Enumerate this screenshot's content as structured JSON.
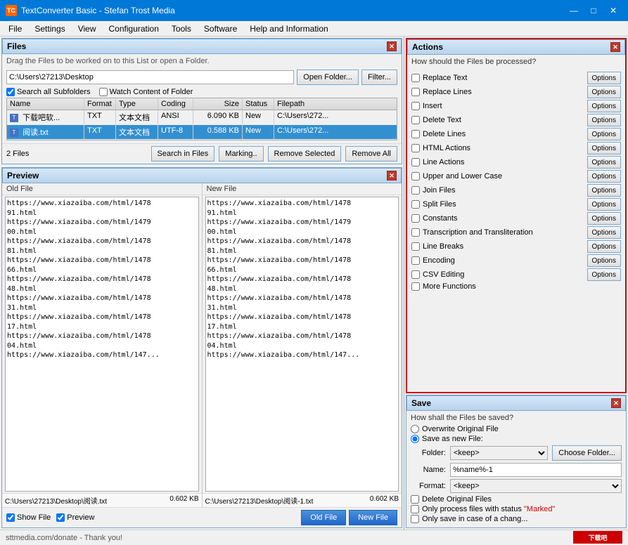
{
  "titleBar": {
    "icon": "TC",
    "title": "TextConverter Basic - Stefan Trost Media",
    "minimizeBtn": "—",
    "maximizeBtn": "□",
    "closeBtn": "✕"
  },
  "menuBar": {
    "items": [
      "File",
      "Settings",
      "View",
      "Configuration",
      "Tools",
      "Software",
      "Help and Information"
    ]
  },
  "files": {
    "panelTitle": "Files",
    "dragHint": "Drag the Files to be worked on to this List or open a Folder.",
    "pathValue": "C:\\Users\\27213\\Desktop",
    "openFolderBtn": "Open Folder...",
    "filterBtn": "Filter...",
    "searchAllSubfolders": "Search all Subfolders",
    "watchContentOfFolder": "Watch Content of Folder",
    "columns": [
      "Name",
      "Format",
      "Type",
      "Coding",
      "Size",
      "Status",
      "Filepath"
    ],
    "rows": [
      {
        "name": "下载吧软...",
        "format": "TXT",
        "type": "文本文档",
        "coding": "ANSI",
        "size": "6.090 KB",
        "status": "New",
        "filepath": "C:\\Users\\272..."
      },
      {
        "name": "阅读.txt",
        "format": "TXT",
        "type": "文本文档",
        "coding": "UTF-8",
        "size": "0.588 KB",
        "status": "New",
        "filepath": "C:\\Users\\272..."
      }
    ],
    "count": "2 Files",
    "searchInFilesBtn": "Search in Files",
    "markingBtn": "Marking..",
    "removeSelectedBtn": "Remove Selected",
    "removeAllBtn": "Remove All"
  },
  "preview": {
    "panelTitle": "Preview",
    "oldFileLabel": "Old File",
    "newFileLabel": "New File",
    "oldFileContent": "https://www.xiazaiba.com/html/1478\n91.html\nhttps://www.xiazaiba.com/html/1479\n00.html\nhttps://www.xiazaiba.com/html/1478\n81.html\nhttps://www.xiazaiba.com/html/1478\n66.html\nhttps://www.xiazaiba.com/html/1478\n48.html\nhttps://www.xiazaiba.com/html/1478\n31.html\nhttps://www.xiazaiba.com/html/1478\n17.html\nhttps://www.xiazaiba.com/html/1478\n04.html\nhttps://www.xiazaiba.com/html/147...",
    "newFileContent": "https://www.xiazaiba.com/html/1478\n91.html\nhttps://www.xiazaiba.com/html/1479\n00.html\nhttps://www.xiazaiba.com/html/1478\n81.html\nhttps://www.xiazaiba.com/html/1478\n66.html\nhttps://www.xiazaiba.com/html/1478\n48.html\nhttps://www.xiazaiba.com/html/1478\n31.html\nhttps://www.xiazaiba.com/html/1478\n17.html\nhttps://www.xiazaiba.com/html/1478\n04.html\nhttps://www.xiazaiba.com/html/147...",
    "oldFilePath": "C:\\Users\\27213\\Desktop\\阅读.txt",
    "oldFileSize": "0.602 KB",
    "newFilePath": "C:\\Users\\27213\\Desktop\\阅读-1.txt",
    "newFileSize": "0.602 KB",
    "showFileLabel": "Show File",
    "previewLabel": "Preview",
    "oldFileBtn": "Old File",
    "newFileBtn": "New File"
  },
  "actions": {
    "panelTitle": "Actions",
    "hint": "How should the Files be processed?",
    "items": [
      {
        "label": "Replace Text",
        "hasOptions": true,
        "checked": false
      },
      {
        "label": "Replace Lines",
        "hasOptions": true,
        "checked": false
      },
      {
        "label": "Insert",
        "hasOptions": true,
        "checked": false
      },
      {
        "label": "Delete Text",
        "hasOptions": true,
        "checked": false
      },
      {
        "label": "Delete Lines",
        "hasOptions": true,
        "checked": false
      },
      {
        "label": "HTML Actions",
        "hasOptions": true,
        "checked": false
      },
      {
        "label": "Line Actions",
        "hasOptions": true,
        "checked": false
      },
      {
        "label": "Upper and Lower Case",
        "hasOptions": true,
        "checked": false
      },
      {
        "label": "Join Files",
        "hasOptions": true,
        "checked": false
      },
      {
        "label": "Split Files",
        "hasOptions": true,
        "checked": false
      },
      {
        "label": "Constants",
        "hasOptions": true,
        "checked": false
      },
      {
        "label": "Transcription and Transliteration",
        "hasOptions": true,
        "checked": false
      },
      {
        "label": "Line Breaks",
        "hasOptions": true,
        "checked": false
      },
      {
        "label": "Encoding",
        "hasOptions": true,
        "checked": false
      },
      {
        "label": "CSV Editing",
        "hasOptions": true,
        "checked": false
      },
      {
        "label": "More Functions",
        "hasOptions": false,
        "checked": false
      }
    ],
    "optionsBtnLabel": "Options"
  },
  "save": {
    "panelTitle": "Save",
    "hint": "How shall the Files be saved?",
    "overwriteOriginal": "Overwrite Original File",
    "saveAsNew": "Save as new File:",
    "folderLabel": "Folder:",
    "folderValue": "<keep>",
    "chooseFolderBtn": "Choose Folder...",
    "nameLabel": "Name:",
    "nameValue": "%name%-1",
    "formatLabel": "Format:",
    "formatValue": "<keep>",
    "deleteOriginalFiles": "Delete Original Files",
    "onlyProcessMarked": "Only process files with status \"Marked\"",
    "onlySaveIfChange": "Only save in case of a chang..."
  },
  "statusBar": {
    "text": "sttmedia.com/donate - Thank you!",
    "logo": "下载吧"
  }
}
